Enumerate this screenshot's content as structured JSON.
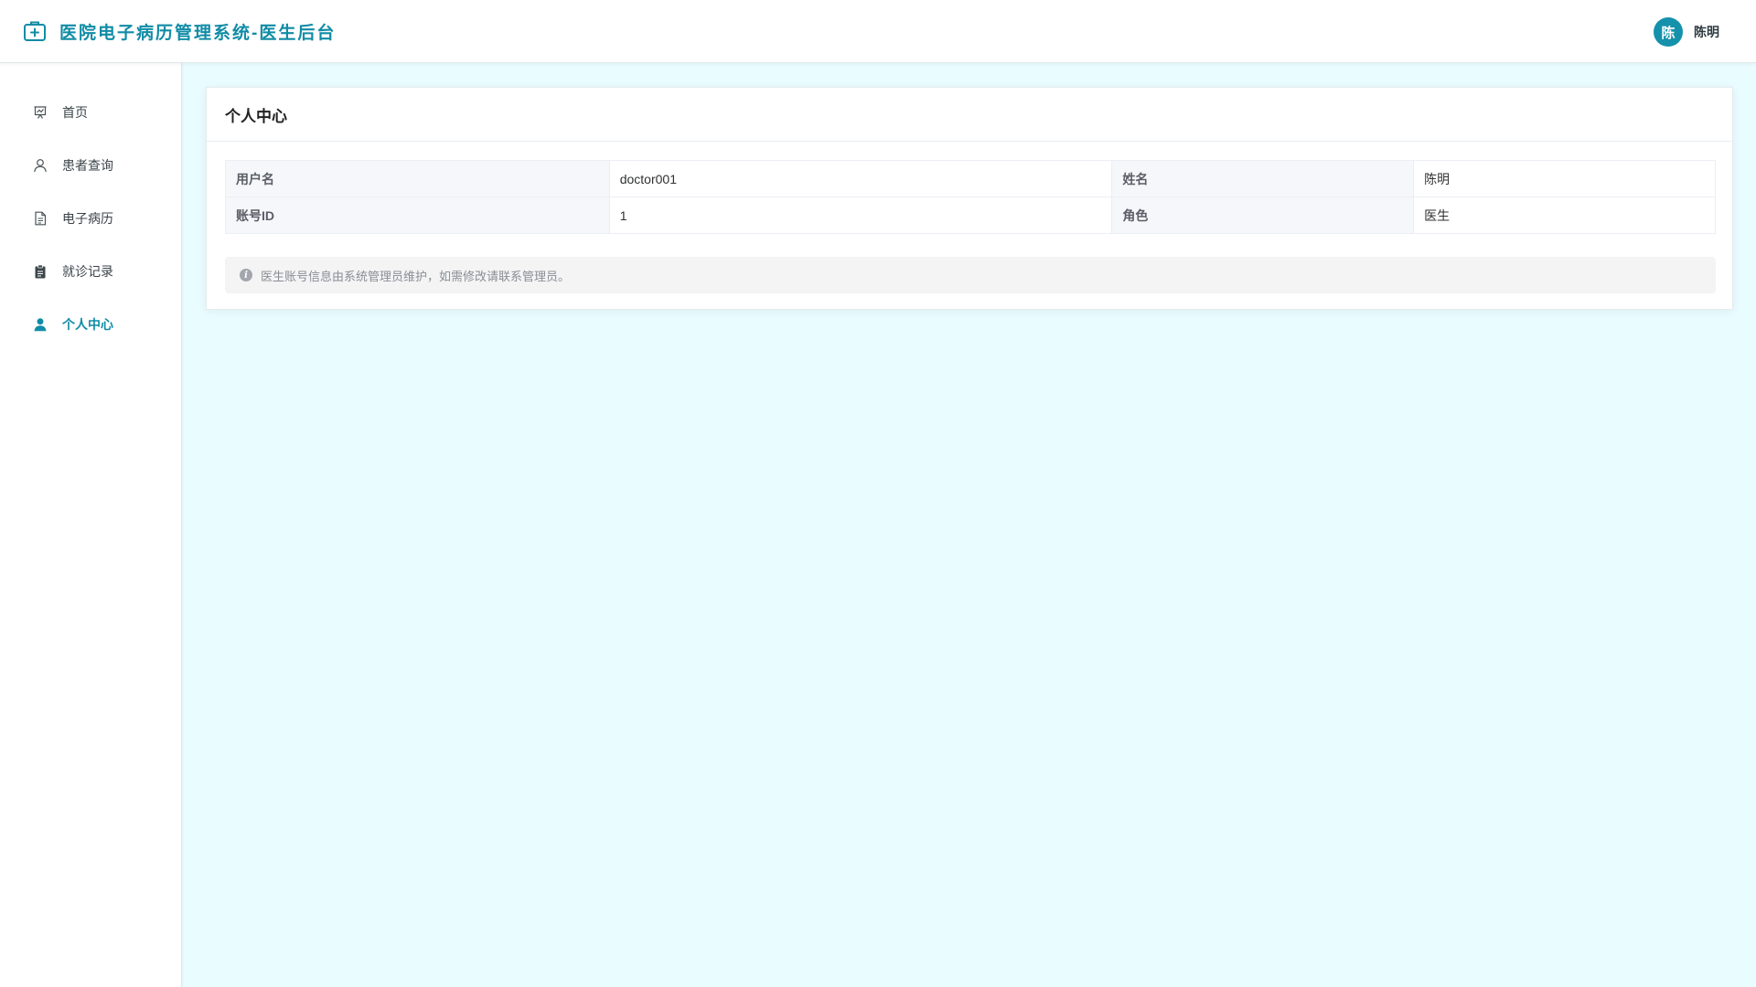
{
  "header": {
    "title": "医院电子病历管理系统-医生后台",
    "brand_icon": "medical-kit-icon",
    "user": {
      "avatar_text": "陈",
      "name": "陈明"
    }
  },
  "sidebar": {
    "items": [
      {
        "label": "首页",
        "icon": "dashboard-icon",
        "active": false
      },
      {
        "label": "患者查询",
        "icon": "user-icon",
        "active": false
      },
      {
        "label": "电子病历",
        "icon": "document-icon",
        "active": false
      },
      {
        "label": "就诊记录",
        "icon": "clipboard-icon",
        "active": false
      },
      {
        "label": "个人中心",
        "icon": "user-filled-icon",
        "active": true
      }
    ]
  },
  "profile": {
    "title": "个人中心",
    "rows": [
      [
        {
          "label": "用户名",
          "value": "doctor001"
        },
        {
          "label": "姓名",
          "value": "陈明"
        }
      ],
      [
        {
          "label": "账号ID",
          "value": "1"
        },
        {
          "label": "角色",
          "value": "医生"
        }
      ]
    ],
    "notice": "医生账号信息由系统管理员维护，如需修改请联系管理员。"
  },
  "colors": {
    "accent": "#118ca6",
    "background": "#e9fcff",
    "avatar": "#1591ab"
  }
}
